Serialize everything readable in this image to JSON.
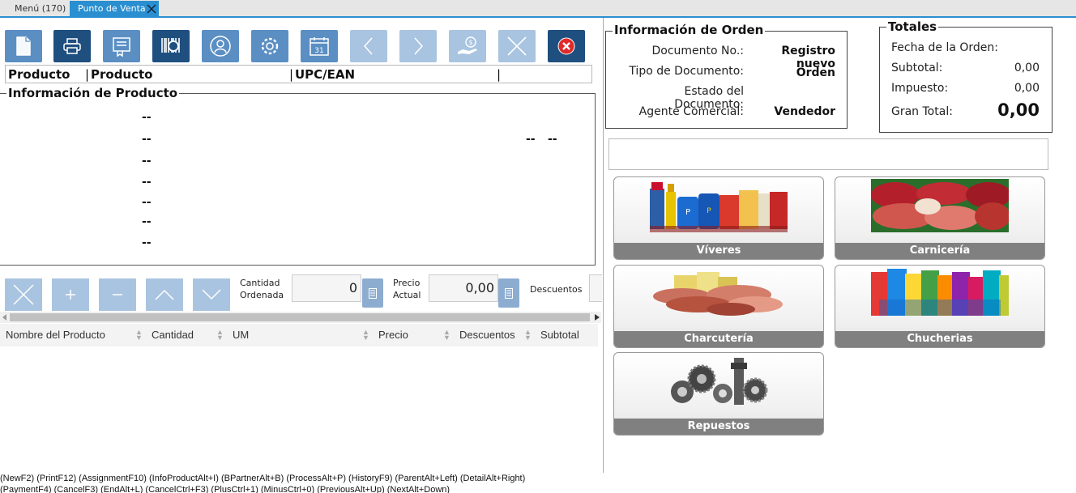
{
  "tabs": {
    "menu": "Menú (170)",
    "active": "Punto de Venta"
  },
  "toolbar": [
    "new-document-icon",
    "print-icon",
    "invoice-icon",
    "barcode-search-icon",
    "business-partner-icon",
    "process-gear-icon",
    "calendar-icon",
    "previous-icon",
    "next-icon",
    "payment-icon",
    "cancel-icon",
    "close-icon"
  ],
  "calendar_day": "31",
  "search": {
    "col1": "Producto",
    "col2": "Producto",
    "col3": "UPC/EAN"
  },
  "product_info": {
    "title": "Información de Producto",
    "dashes": [
      "--",
      "--",
      "--",
      "--",
      "--",
      "--",
      "--"
    ],
    "right_dash1": "--",
    "right_dash2": "--"
  },
  "actions": {
    "qty_label_1": "Cantidad",
    "qty_label_2": "Ordenada",
    "qty_value": "0",
    "price_label_1": "Precio",
    "price_label_2": "Actual",
    "price_value": "0,00",
    "discount_label": "Descuentos"
  },
  "grid": {
    "columns": [
      "Nombre del Producto",
      "Cantidad",
      "UM",
      "Precio",
      "Descuentos",
      "Subtotal"
    ]
  },
  "order_info": {
    "title": "Información de Orden",
    "doc_no_label": "Documento No.:",
    "doc_no_value": "Registro nuevo",
    "doc_type_label": "Tipo de Documento:",
    "doc_type_value": "Orden",
    "status_label": "Estado del Documento:",
    "status_value": "",
    "agent_label": "Agente Comercial:",
    "agent_value": "Vendedor"
  },
  "totals": {
    "title": "Totales",
    "date_label": "Fecha de la Orden:",
    "subtotal_label": "Subtotal:",
    "subtotal_value": "0,00",
    "tax_label": "Impuesto:",
    "tax_value": "0,00",
    "grand_label": "Gran Total:",
    "grand_value": "0,00"
  },
  "categories": [
    "Víveres",
    "Carnicería",
    "Charcutería",
    "Chucherias",
    "Repuestos"
  ],
  "shortcuts": {
    "line1": "(NewF2) (PrintF12) (AssignmentF10) (InfoProductAlt+I) (BPartnerAlt+B) (ProcessAlt+P) (HistoryF9) (ParentAlt+Left) (DetailAlt+Right)",
    "line2": "(PaymentF4) (CancelF3) (EndAlt+L) (CancelCtrl+F3) (PlusCtrl+1) (MinusCtrl+0) (PreviousAlt+Up) (NextAlt+Down)"
  }
}
